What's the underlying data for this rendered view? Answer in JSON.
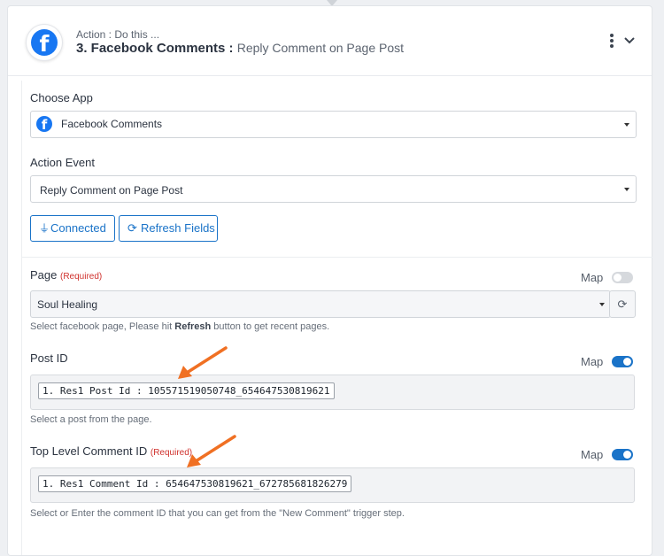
{
  "header": {
    "action_label": "Action : Do this ...",
    "step_title": "3. Facebook Comments : ",
    "step_event": "Reply Comment on Page Post",
    "app_icon": "facebook-icon",
    "logo_letter": "f"
  },
  "choose_app": {
    "label": "Choose App",
    "value": "Facebook Comments",
    "icon_letter": "f"
  },
  "action_event": {
    "label": "Action Event",
    "value": "Reply Comment on Page Post"
  },
  "buttons": {
    "connected": "Connected",
    "refresh_fields": "Refresh Fields"
  },
  "page_field": {
    "label": "Page",
    "required": "(Required)",
    "map_label": "Map",
    "map_on": false,
    "value": "Soul Healing",
    "help_pre": "Select facebook page, Please hit ",
    "help_bold": "Refresh",
    "help_post": " button to get recent pages."
  },
  "post_id": {
    "label": "Post ID",
    "map_label": "Map",
    "map_on": true,
    "chip": "1. Res1 Post Id : 105571519050748_654647530819621",
    "help": "Select a post from the page."
  },
  "comment_id": {
    "label": "Top Level Comment ID",
    "required": "(Required)",
    "map_label": "Map",
    "map_on": true,
    "chip": "1. Res1 Comment Id : 654647530819621_672785681826279",
    "help": "Select or Enter the comment ID that you can get from the \"New Comment\" trigger step."
  },
  "colors": {
    "accent": "#1a73c8",
    "facebook": "#1877f2",
    "annotation_arrow": "#f07023",
    "required": "#d0312d"
  }
}
